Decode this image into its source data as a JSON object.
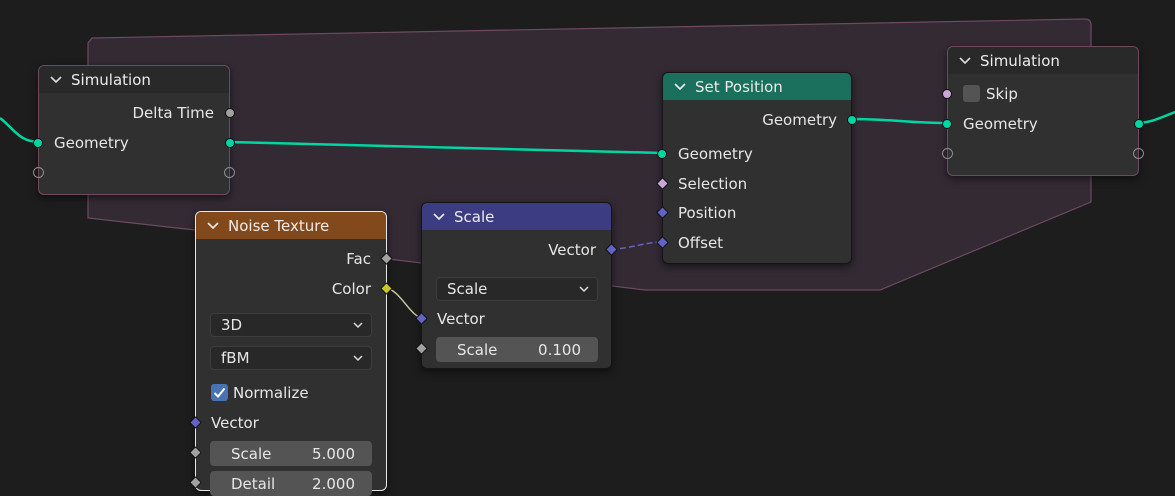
{
  "nodes": {
    "sim_input": {
      "title": "Simulation",
      "outputs": [
        "Delta Time",
        "Geometry"
      ],
      "inputs": [
        "Geometry"
      ]
    },
    "set_position": {
      "title": "Set Position",
      "output": "Geometry",
      "inputs": [
        "Geometry",
        "Selection",
        "Position",
        "Offset"
      ]
    },
    "sim_output": {
      "title": "Simulation",
      "skip_label": "Skip",
      "geometry_label": "Geometry"
    },
    "noise_texture": {
      "title": "Noise Texture",
      "outputs": [
        "Fac",
        "Color"
      ],
      "dimension": "3D",
      "type": "fBM",
      "normalize_label": "Normalize",
      "normalize_checked": true,
      "vector_label": "Vector",
      "scale_label": "Scale",
      "scale_value": "5.000",
      "detail_label": "Detail",
      "detail_value": "2.000"
    },
    "scale": {
      "title": "Scale",
      "output": "Vector",
      "operation": "Scale",
      "vector_label": "Vector",
      "scale_label": "Scale",
      "scale_value": "0.100"
    }
  },
  "colors": {
    "background": "#1d1d1d",
    "node_body": "#303030",
    "sim_header": "#292929",
    "sim_zone": "#332a33",
    "sim_zone_border": "#6d4a62",
    "geometry_socket": "#00d6a3",
    "vector_socket": "#6363c7",
    "color_socket": "#c7c729",
    "float_socket": "#a1a1a1",
    "bool_socket": "#cca6d6",
    "noise_header": "#83491b",
    "set_position_header": "#1b6f5d",
    "scale_header": "#3c3c83",
    "checkbox_on": "#4772b3"
  }
}
